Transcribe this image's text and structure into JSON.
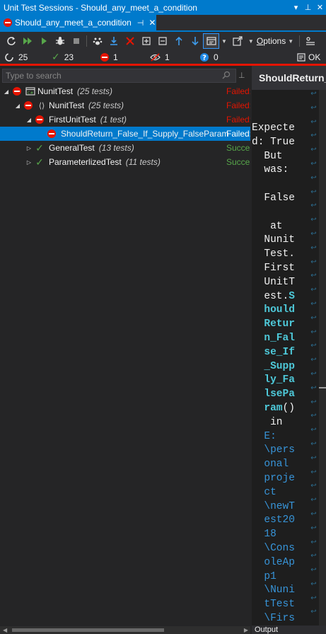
{
  "window": {
    "title": "Unit Test Sessions - Should_any_meet_a_condition",
    "controls": [
      "▾",
      "⊥",
      "✕"
    ]
  },
  "tab": {
    "label": "Should_any_meet_a_condition",
    "pin_icon": "⊣",
    "close_icon": "✕"
  },
  "toolbar": {
    "options_label": "Options",
    "options_underline": "O",
    "options_rest": "ptions"
  },
  "counts": {
    "total": "25",
    "passed": "23",
    "failed": "1",
    "ignored": "1",
    "unknown": "0",
    "ok_label": "OK"
  },
  "search": {
    "placeholder": "Type to search"
  },
  "tree": [
    {
      "name": "NunitTest",
      "count": "(25 tests)",
      "status": "Failed:",
      "state": "failed",
      "level": 0,
      "expanded": true,
      "type": "project"
    },
    {
      "name": "NunitTest",
      "count": "(25 tests)",
      "status": "Failed:",
      "state": "failed",
      "level": 1,
      "expanded": true,
      "type": "namespace"
    },
    {
      "name": "FirstUnitTest",
      "count": "(1 test)",
      "status": "Failed:",
      "state": "failed",
      "level": 2,
      "expanded": true,
      "type": "class"
    },
    {
      "name": "ShouldReturn_False_If_Supply_FalseParam",
      "count": "",
      "status": "Failed:",
      "state": "failed",
      "level": 3,
      "expanded": false,
      "type": "test",
      "selected": true
    },
    {
      "name": "GeneralTest",
      "count": "(13 tests)",
      "status": "Success",
      "state": "success",
      "level": 2,
      "expanded": false,
      "type": "class"
    },
    {
      "name": "ParameterlizedTest",
      "count": "(11 tests)",
      "status": "Success",
      "state": "success",
      "level": 2,
      "expanded": false,
      "type": "class"
    }
  ],
  "details": {
    "header": "ShouldReturn_False_If_Supply_FalseParam",
    "output_lines": [
      {
        "text": "Expecte",
        "style": "plain"
      },
      {
        "text": "d: True",
        "style": "plain"
      },
      {
        "text": "  But",
        "style": "plain"
      },
      {
        "text": "  was:",
        "style": "plain"
      },
      {
        "text": "",
        "style": "plain"
      },
      {
        "text": "  False",
        "style": "plain"
      },
      {
        "text": "",
        "style": "plain"
      },
      {
        "text": "   at",
        "style": "plain"
      },
      {
        "text": "  Nunit",
        "style": "plain"
      },
      {
        "text": "  Test.",
        "style": "plain"
      },
      {
        "text": "  First",
        "style": "plain"
      },
      {
        "text": "  UnitT",
        "style": "plain"
      },
      {
        "text": "  est.S",
        "style": "mixed",
        "plain": "  est.",
        "cyan": "S"
      },
      {
        "text": "  hould",
        "style": "cyan"
      },
      {
        "text": "  Retur",
        "style": "cyan"
      },
      {
        "text": "  n_Fal",
        "style": "cyan"
      },
      {
        "text": "  se_If",
        "style": "cyan"
      },
      {
        "text": "  _Supp",
        "style": "cyan"
      },
      {
        "text": "  ly_Fa",
        "style": "cyan"
      },
      {
        "text": "  lsePa",
        "style": "cyan"
      },
      {
        "text": "  ram()",
        "style": "mixed",
        "plain_after": "()",
        "cyan_first": "  ram"
      },
      {
        "text": "   in",
        "style": "plain"
      },
      {
        "text": "  E:",
        "style": "path"
      },
      {
        "text": "  \\pers",
        "style": "path"
      },
      {
        "text": "  onal",
        "style": "path"
      },
      {
        "text": "  proje",
        "style": "path"
      },
      {
        "text": "  ct",
        "style": "path"
      },
      {
        "text": "  \\newT",
        "style": "path"
      },
      {
        "text": "  est20",
        "style": "path"
      },
      {
        "text": "  18",
        "style": "path"
      },
      {
        "text": "  \\Cons",
        "style": "path"
      },
      {
        "text": "  oleAp",
        "style": "path"
      },
      {
        "text": "  p1",
        "style": "path"
      },
      {
        "text": "  \\Nuni",
        "style": "path"
      },
      {
        "text": "  tTest",
        "style": "path"
      },
      {
        "text": "  \\Firs",
        "style": "path"
      }
    ],
    "output_tab": "Output"
  },
  "colors": {
    "accent": "#007acc",
    "failed": "#e51400",
    "success": "#57a64a",
    "highlight": "#4ec9d9",
    "path": "#3794d8"
  }
}
